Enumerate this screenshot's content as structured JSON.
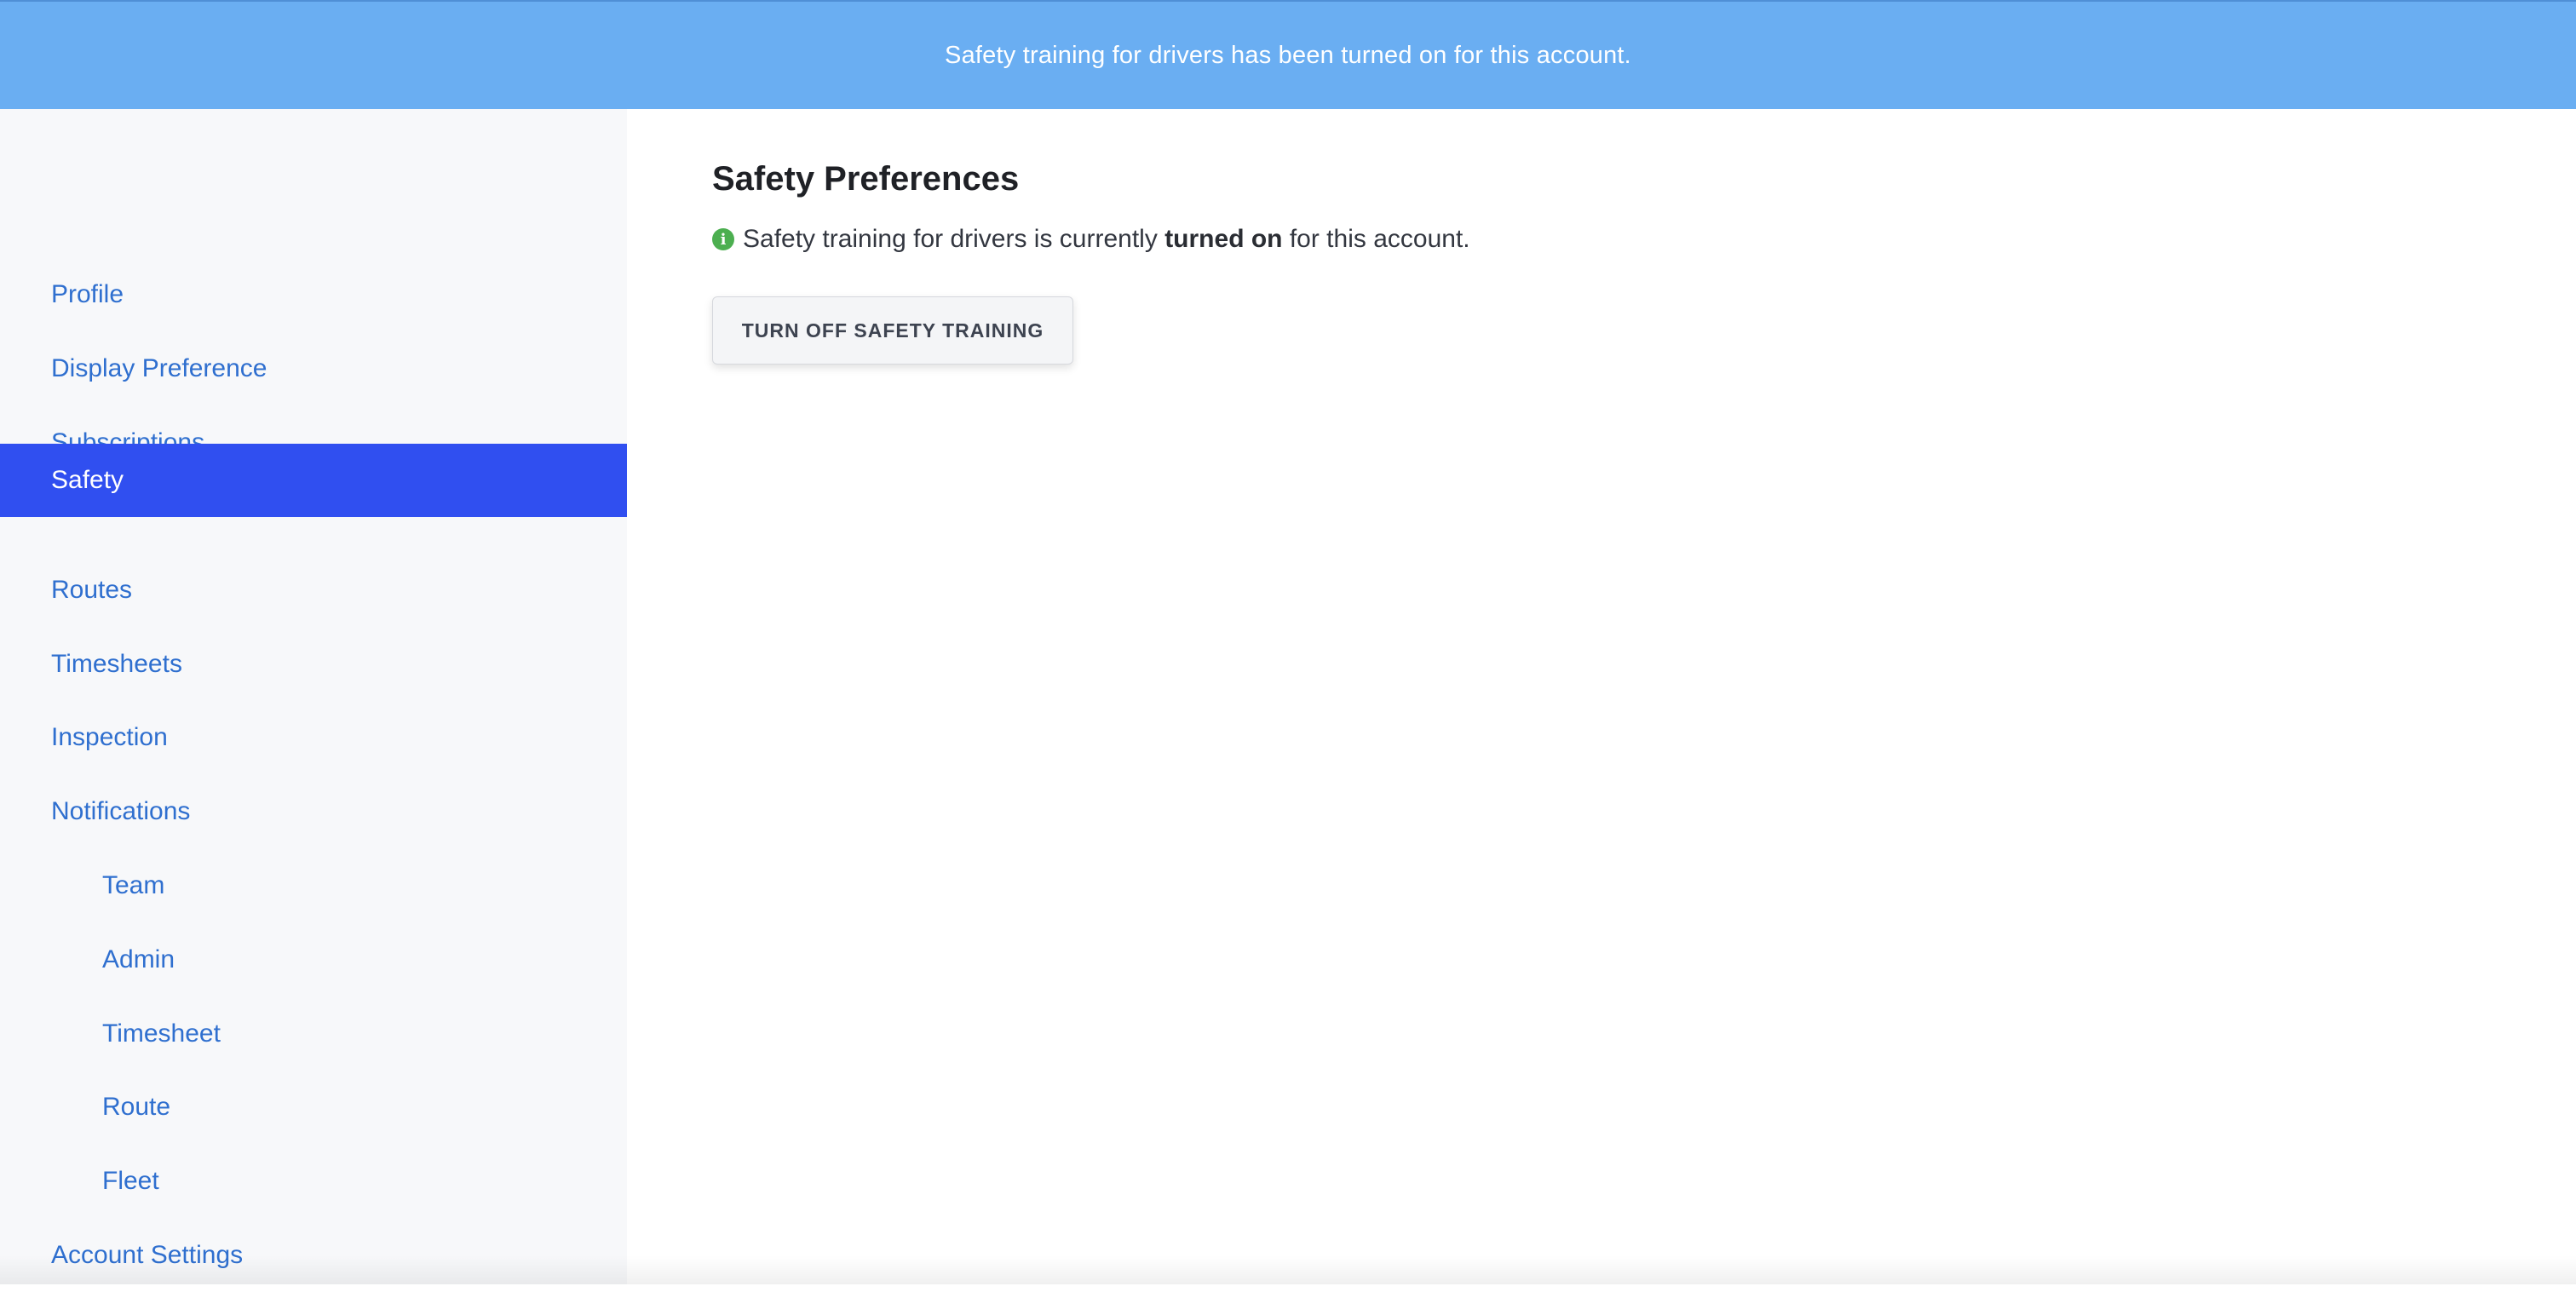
{
  "banner": {
    "message": "Safety training for drivers has been turned on for this account."
  },
  "sidebar": {
    "items": [
      {
        "label": "Profile"
      },
      {
        "label": "Display Preference"
      },
      {
        "label": "Subscriptions"
      },
      {
        "label": "Safety",
        "active": true
      },
      {
        "label": "Routes"
      },
      {
        "label": "Timesheets"
      },
      {
        "label": "Inspection"
      },
      {
        "label": "Notifications"
      },
      {
        "label": "Team",
        "indent": true
      },
      {
        "label": "Admin",
        "indent": true
      },
      {
        "label": "Timesheet",
        "indent": true
      },
      {
        "label": "Route",
        "indent": true
      },
      {
        "label": "Fleet",
        "indent": true
      },
      {
        "label": "Account Settings"
      }
    ]
  },
  "main": {
    "title": "Safety Preferences",
    "status": {
      "prefix": "Safety training for drivers is currently ",
      "state": "turned on",
      "suffix": " for this account.",
      "icon": "info-icon"
    },
    "toggle_button_label": "TURN OFF SAFETY TRAINING"
  },
  "colors": {
    "banner": "#6aaef2",
    "active_nav": "#304ff0",
    "link": "#2f6fcf",
    "info_icon": "#4caf50"
  }
}
